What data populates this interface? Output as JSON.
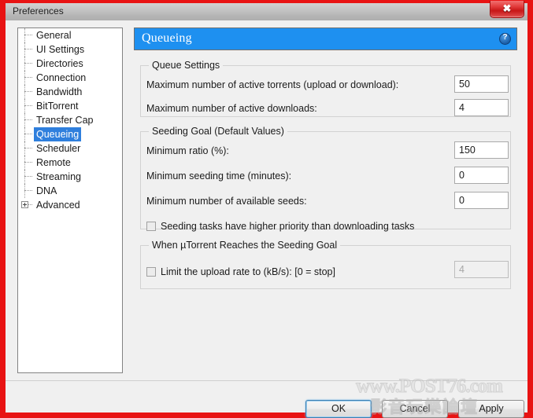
{
  "window": {
    "title": "Preferences",
    "close_label": "✖"
  },
  "sidebar": {
    "items": [
      {
        "label": "General",
        "selected": false,
        "expandable": false
      },
      {
        "label": "UI Settings",
        "selected": false,
        "expandable": false
      },
      {
        "label": "Directories",
        "selected": false,
        "expandable": false
      },
      {
        "label": "Connection",
        "selected": false,
        "expandable": false
      },
      {
        "label": "Bandwidth",
        "selected": false,
        "expandable": false
      },
      {
        "label": "BitTorrent",
        "selected": false,
        "expandable": false
      },
      {
        "label": "Transfer Cap",
        "selected": false,
        "expandable": false
      },
      {
        "label": "Queueing",
        "selected": true,
        "expandable": false
      },
      {
        "label": "Scheduler",
        "selected": false,
        "expandable": false
      },
      {
        "label": "Remote",
        "selected": false,
        "expandable": false
      },
      {
        "label": "Streaming",
        "selected": false,
        "expandable": false
      },
      {
        "label": "DNA",
        "selected": false,
        "expandable": false
      },
      {
        "label": "Advanced",
        "selected": false,
        "expandable": true
      }
    ]
  },
  "main": {
    "header_title": "Queueing",
    "help_glyph": "?",
    "groups": {
      "queue_settings": {
        "legend": "Queue Settings",
        "fields": [
          {
            "label": "Maximum number of active torrents (upload or download):",
            "value": "50"
          },
          {
            "label": "Maximum number of active downloads:",
            "value": "4"
          }
        ]
      },
      "seeding_goal": {
        "legend": "Seeding Goal (Default Values)",
        "fields": [
          {
            "label": "Minimum ratio (%):",
            "value": "150"
          },
          {
            "label": "Minimum seeding time (minutes):",
            "value": "0"
          },
          {
            "label": "Minimum number of available seeds:",
            "value": "0"
          }
        ],
        "checkbox": {
          "label": "Seeding tasks have higher priority than downloading tasks",
          "checked": false
        }
      },
      "reaches_goal": {
        "legend": "When µTorrent Reaches the Seeding Goal",
        "checkbox": {
          "label": "Limit the upload rate to (kB/s): [0 = stop]",
          "checked": false
        },
        "value": "4",
        "disabled": true
      }
    }
  },
  "footer": {
    "ok_label": "OK",
    "cancel_label": "Cancel",
    "apply_label": "Apply"
  },
  "watermark": {
    "line1": "www.POST76.com",
    "line2": "影音玩樂論壇"
  },
  "colors": {
    "frame_red": "#e81313",
    "header_blue": "#1e90f0",
    "selection_blue": "#2f7fdd",
    "dialog_gray": "#f0f0f0"
  }
}
